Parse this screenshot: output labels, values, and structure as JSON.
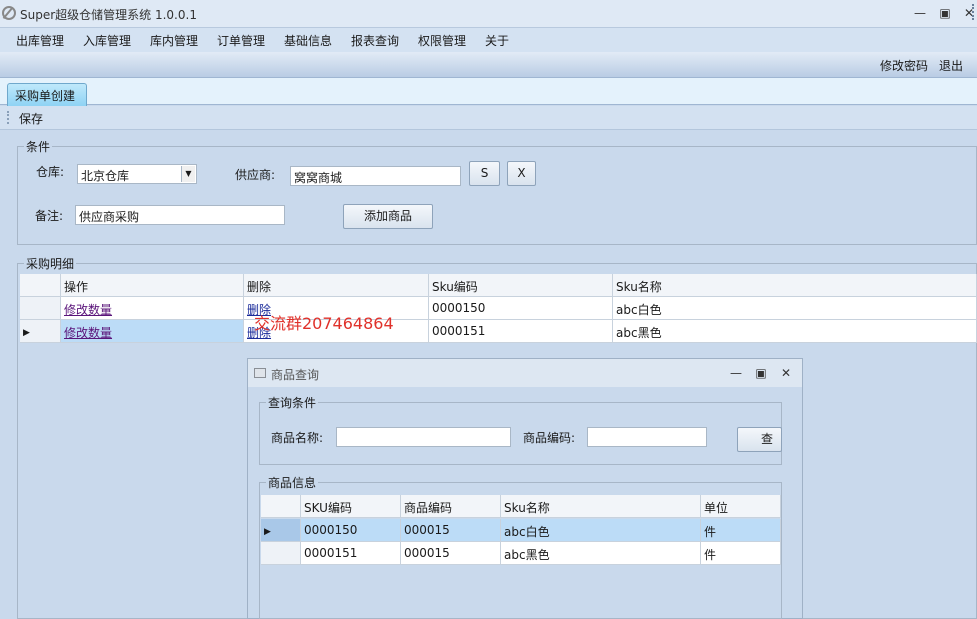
{
  "window": {
    "title": "Super超级仓储管理系统 1.0.0.1",
    "controls": [
      "—",
      "▣",
      "✕"
    ]
  },
  "menu": [
    "出库管理",
    "入库管理",
    "库内管理",
    "订单管理",
    "基础信息",
    "报表查询",
    "权限管理",
    "关于"
  ],
  "toolbar": {
    "change_password": "修改密码",
    "logout": "退出"
  },
  "tab": {
    "label": "采购单创建"
  },
  "actions": {
    "save": "保存"
  },
  "conditions": {
    "group_title": "条件",
    "warehouse_label": "仓库:",
    "warehouse_value": "北京仓库",
    "supplier_label": "供应商:",
    "supplier_value": "窝窝商城",
    "s_button": "S",
    "x_button": "X",
    "note_label": "备注:",
    "note_value": "供应商采购",
    "add_goods_button": "添加商品"
  },
  "details": {
    "group_title": "采购明细",
    "columns": [
      "操作",
      "删除",
      "Sku编码",
      "Sku名称"
    ],
    "rows": [
      {
        "op": "修改数量",
        "del": "删除",
        "sku": "0000150",
        "name": "abc白色"
      },
      {
        "op": "修改数量",
        "del": "删除",
        "sku": "0000151",
        "name": "abc黑色"
      }
    ]
  },
  "watermark": "交流群207464864",
  "goods_dialog": {
    "title": "商品查询",
    "controls": [
      "—",
      "▣",
      "✕"
    ],
    "query_group_title": "查询条件",
    "name_label": "商品名称:",
    "name_value": "",
    "code_label": "商品编码:",
    "code_value": "",
    "query_button": "查",
    "info_group_title": "商品信息",
    "columns": [
      "SKU编码",
      "商品编码",
      "Sku名称",
      "单位"
    ],
    "rows": [
      {
        "sku": "0000150",
        "code": "000015",
        "name": "abc白色",
        "unit": "件"
      },
      {
        "sku": "0000151",
        "code": "000015",
        "name": "abc黑色",
        "unit": "件"
      }
    ]
  },
  "colors": {
    "accent": "#8fd3f4",
    "selected_row": "#bcdcf7",
    "background": "#c9d9ec"
  }
}
